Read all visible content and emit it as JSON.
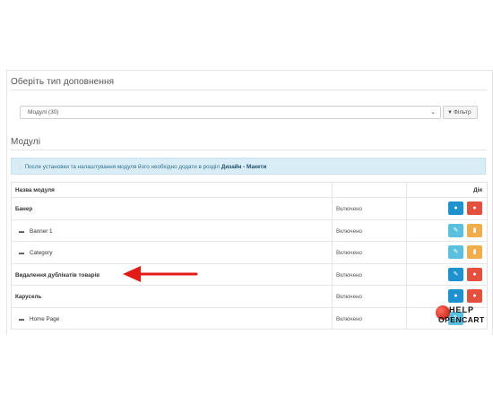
{
  "header": {
    "title": "Оберіть тип доповнення"
  },
  "filter": {
    "select_value": "Модулі (30)",
    "button_label": "Фільтр"
  },
  "modules": {
    "title": "Модулі"
  },
  "alert": {
    "text": "После установки та налаштування модуля його необхідно додати в розділ ",
    "link": "Дизайн - Макети"
  },
  "table": {
    "headers": {
      "name": "Назва модуля",
      "action": "Дія"
    },
    "rows": [
      {
        "name": "Банер",
        "status": "Включено"
      },
      {
        "name": "Banner 1",
        "status": "Включено"
      },
      {
        "name": "Category",
        "status": "Включено"
      },
      {
        "name": "Видалення дублікатів товарів",
        "status": "Включено"
      },
      {
        "name": "Карусель",
        "status": "Включено"
      },
      {
        "name": "Home Page",
        "status": "Включено"
      }
    ]
  },
  "logo": {
    "top": "HELP",
    "bottom": "OPENCART"
  },
  "colors": {
    "primary": "#1e91cf",
    "danger": "#e3503e",
    "info": "#5bc0de",
    "warning": "#f0ad4e",
    "arrow": "#e21b16"
  }
}
